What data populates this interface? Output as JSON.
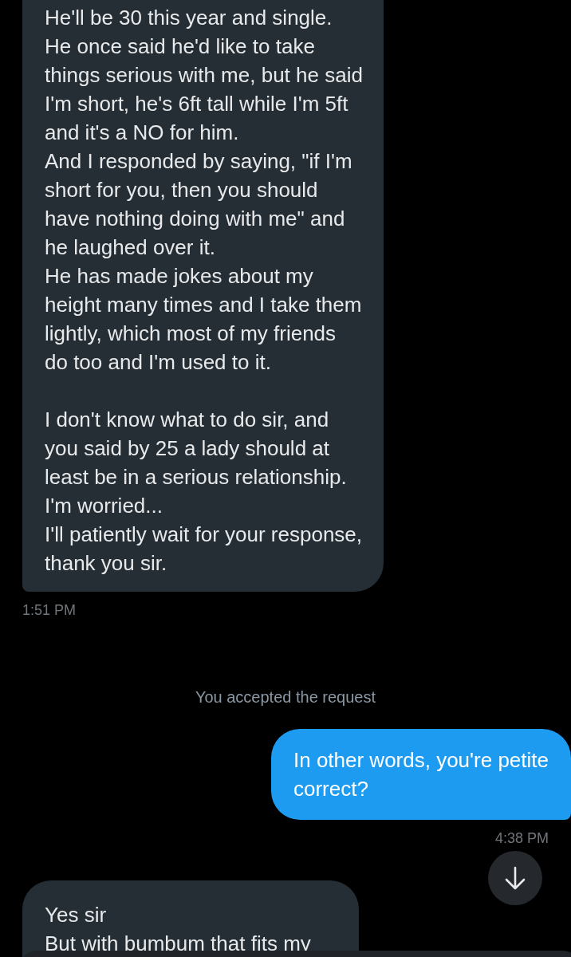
{
  "messages": [
    {
      "kind": "received",
      "paragraphs": [
        [
          "He'll be 30 this year and single.",
          "He once said he'd like to take",
          "things serious with me, but he said",
          "I'm short, he's 6ft tall while I'm 5ft",
          "and it's a NO for him.",
          "And I responded by saying, \"if I'm",
          "short for you, then you should",
          "have nothing doing with me\" and",
          "he laughed over it.",
          "He has made jokes about my",
          "height many times and I take them",
          "lightly, which most of my friends",
          "do too and I'm used to it."
        ],
        [
          "I don't know what to do sir, and",
          "you said by 25 a lady should at",
          "least be in a serious relationship.",
          "I'm worried...",
          "I'll patiently wait for your response,",
          "thank you sir."
        ]
      ],
      "time": "1:51 PM"
    },
    {
      "kind": "notice",
      "text": "You accepted the request"
    },
    {
      "kind": "sent",
      "paragraphs": [
        [
          "In other words, you're petite",
          "correct?"
        ]
      ],
      "time": "4:38 PM"
    },
    {
      "kind": "received",
      "paragraphs": [
        [
          "Yes sir",
          "But with bumbum that fits my"
        ]
      ]
    }
  ]
}
